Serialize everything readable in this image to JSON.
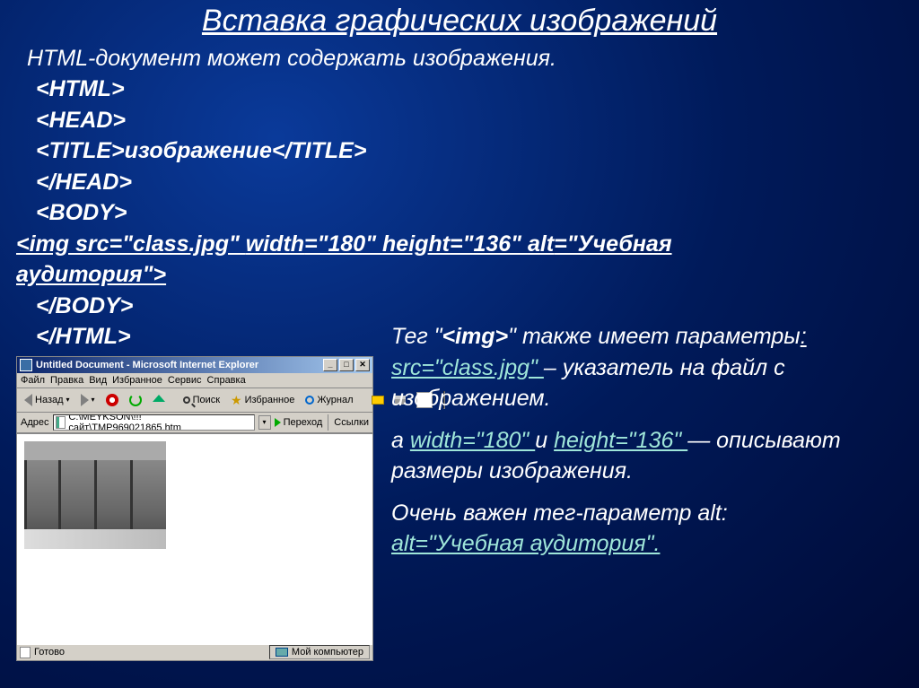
{
  "title": "Вставка графических изображений",
  "intro": "HTML-документ может содержать изображения.",
  "code": {
    "l1": "<HTML>",
    "l2": "<HEAD>",
    "l3": "<TITLE>изображение</TITLE>",
    "l4": "</HEAD>",
    "l5": "<BODY>",
    "l6a": "<img src=\"class.jpg\" ",
    "l6b": "width",
    "l6c": "=\"180\" ",
    "l6d": "height",
    "l6e": "=\"136\" ",
    "l6f": "alt",
    "l6g": "=\"Учебная ",
    "l7": "аудитория\">",
    "l8": "</BODY>",
    "l9": "</HTML>"
  },
  "right": {
    "p1a": "Тег \"",
    "p1b": "<img>",
    "p1c": "\" также имеет параметры",
    "p1d": ": ",
    "p1e": "src=\"class.jpg\" ",
    "p1f": "– указатель на файл с изображением.",
    "p2a": "а ",
    "p2b": " width=\"180\" ",
    "p2c": "и ",
    "p2d": "height=\"136\" ",
    "p2e": "— описывают размеры изображения.",
    "p3a": "Очень важен тег-параметр alt: ",
    "p3b": "alt=\"Учебная аудитория\"."
  },
  "browser": {
    "title": "Untitled Document - Microsoft Internet Explorer",
    "menu": [
      "Файл",
      "Правка",
      "Вид",
      "Избранное",
      "Сервис",
      "Справка"
    ],
    "toolbar": {
      "back": "Назад",
      "search": "Поиск",
      "favorites": "Избранное",
      "history": "Журнал"
    },
    "addrLabel": "Адрес",
    "address": "C:\\MEYKSON\\!!!сайт\\TMP969021865.htm",
    "go": "Переход",
    "links": "Ссылки",
    "status": "Готово",
    "zone": "Мой компьютер"
  }
}
